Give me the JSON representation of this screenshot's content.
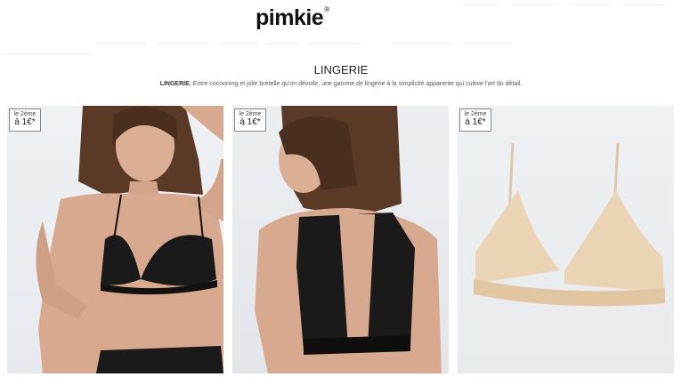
{
  "header": {
    "brand": "pimkie",
    "trademark": "®"
  },
  "category": {
    "title": "LINGERIE",
    "desc_bold": "LINGERIE.",
    "desc_text": " Entre cocooning et jolie bretelle qu'on dévoile, une gamme de lingerie à la simplicité apparente qui cultive l'art du détail."
  },
  "products": [
    {
      "badge_line1": "le 2ème",
      "badge_line2": "à 1€*"
    },
    {
      "badge_line1": "le 2ème",
      "badge_line2": "à 1€*"
    },
    {
      "badge_line1": "le 2ème",
      "badge_line2": "à 1€*"
    }
  ],
  "colors": {
    "skin": "#d8a98e",
    "hair": "#5a3a26",
    "lace_black": "#1a1a1a",
    "lace_nude": "#ead4b4"
  }
}
